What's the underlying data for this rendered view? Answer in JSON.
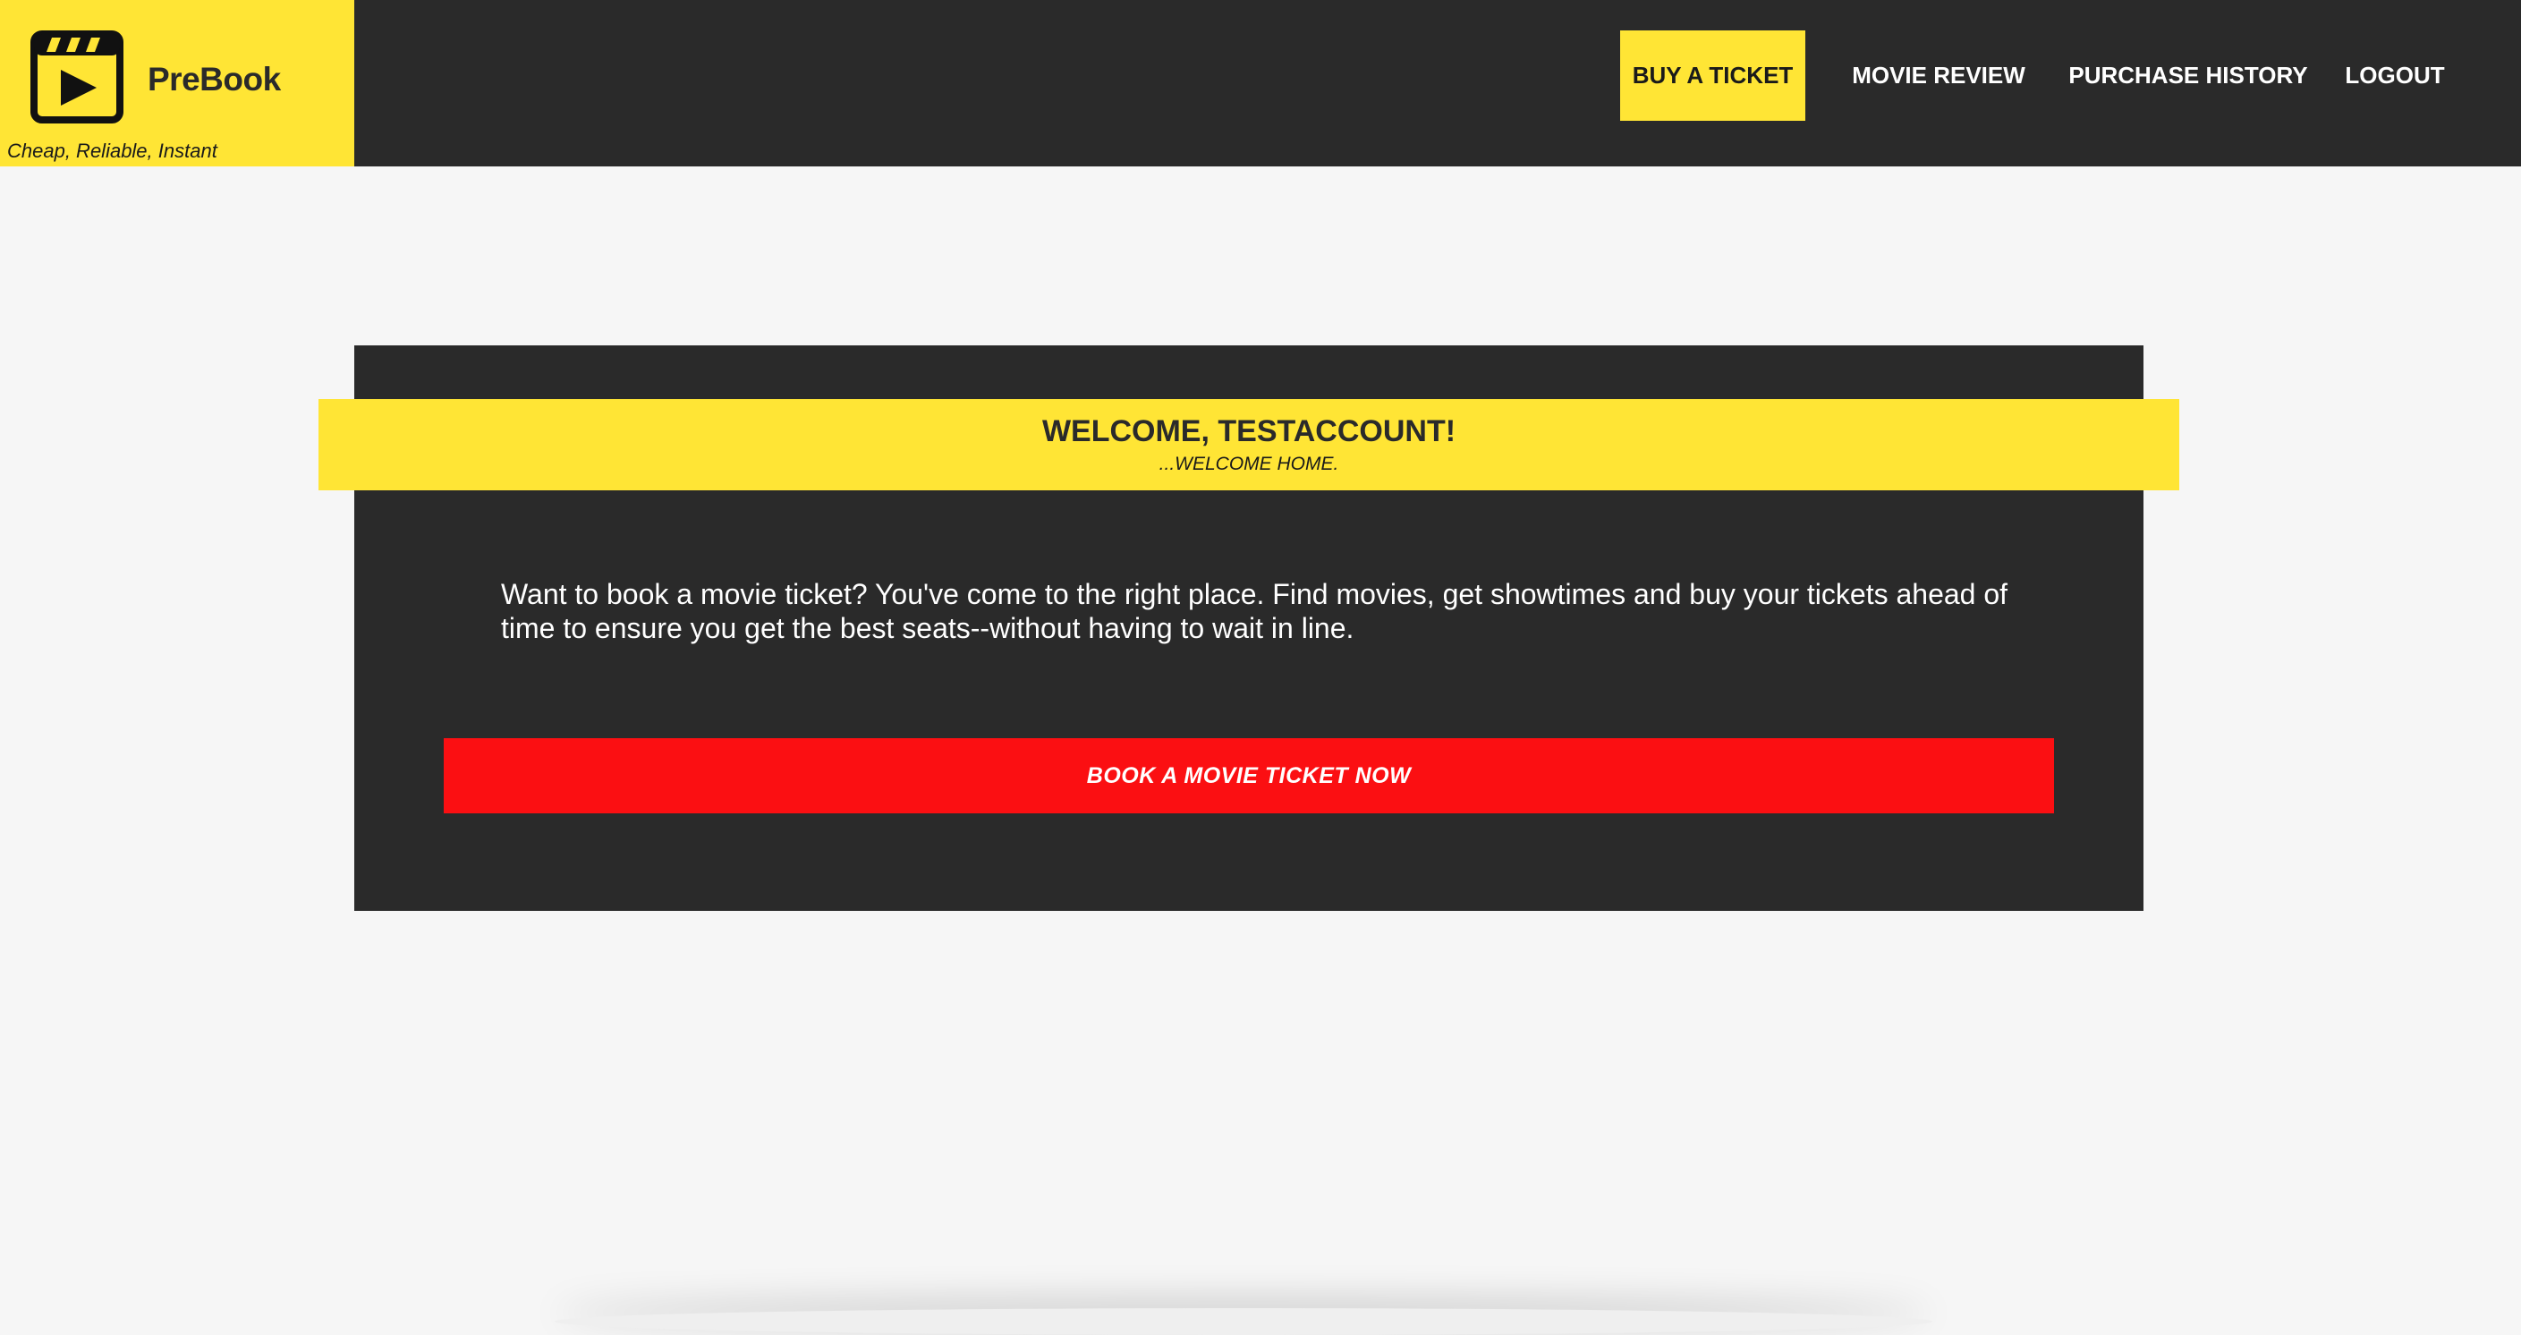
{
  "brand": {
    "name": "PreBook",
    "tagline": "Cheap, Reliable, Instant",
    "logo_icon": "film-play-icon",
    "accent_color": "#ffe535",
    "dark_color": "#2a2a2a"
  },
  "nav": {
    "items": [
      {
        "label": "BUY A TICKET",
        "active": true
      },
      {
        "label": "MOVIE REVIEW",
        "active": false
      },
      {
        "label": "PURCHASE HISTORY",
        "active": false
      },
      {
        "label": "LOGOUT",
        "active": false
      }
    ]
  },
  "welcome": {
    "title": "WELCOME, TESTACCOUNT!",
    "subtitle": "...WELCOME HOME."
  },
  "intro": {
    "text": "Want to book a movie ticket? You've come to the right place. Find movies, get showtimes and buy your tickets ahead of time to ensure you get the best seats--without having to wait in line."
  },
  "cta": {
    "label": "BOOK A MOVIE TICKET NOW",
    "color": "#fb0f12"
  }
}
